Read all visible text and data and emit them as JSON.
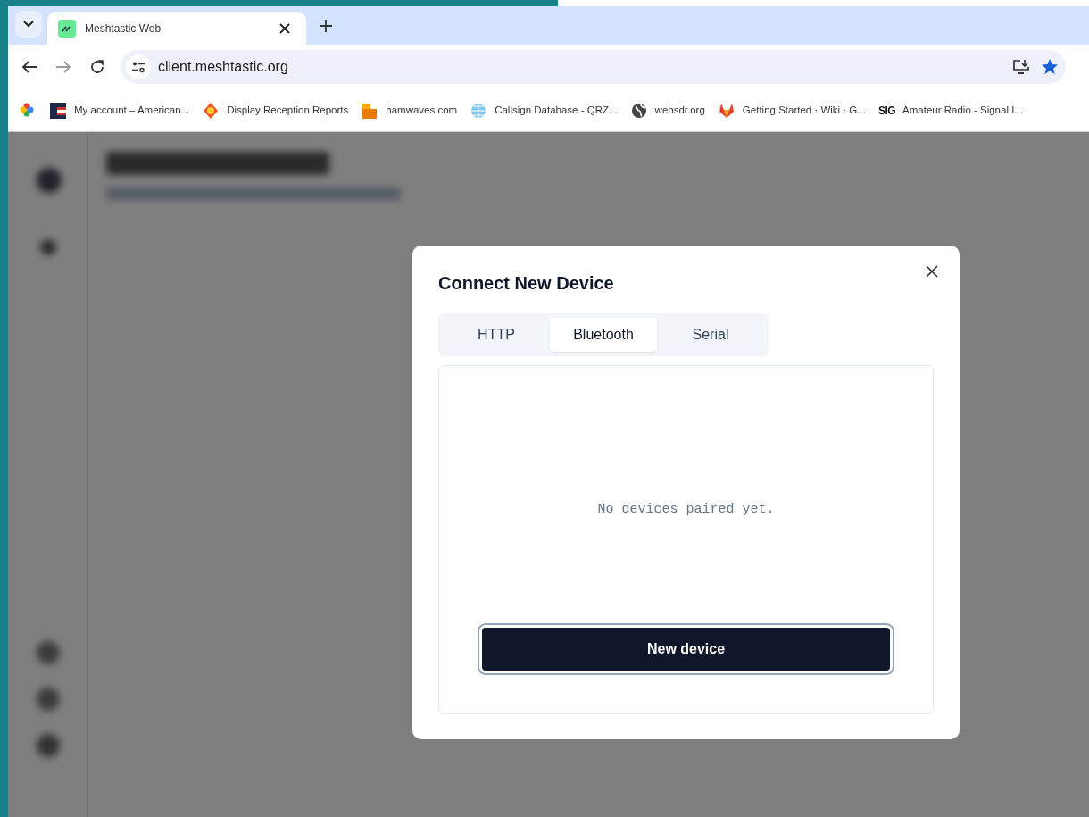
{
  "browser": {
    "tabs": [
      {
        "title": "Meshtastic Web",
        "selected": true
      }
    ],
    "address": "client.meshtastic.org",
    "bookmarked": true,
    "bookmarks": [
      {
        "kind": "icon"
      },
      {
        "label": "My account – American..."
      },
      {
        "label": "Display Reception Reports"
      },
      {
        "label": "hamwaves.com"
      },
      {
        "label": "Callsign Database - QRZ..."
      },
      {
        "label": "websdr.org"
      },
      {
        "label": "Getting Started · Wiki · G..."
      },
      {
        "label": "Amateur Radio - Signal I...",
        "icon_text": "SIG"
      }
    ]
  },
  "dialog": {
    "title": "Connect New Device",
    "tabs": [
      {
        "label": "HTTP",
        "selected": false
      },
      {
        "label": "Bluetooth",
        "selected": true
      },
      {
        "label": "Serial",
        "selected": false
      }
    ],
    "empty_message": "No devices paired yet.",
    "button": "New device"
  }
}
